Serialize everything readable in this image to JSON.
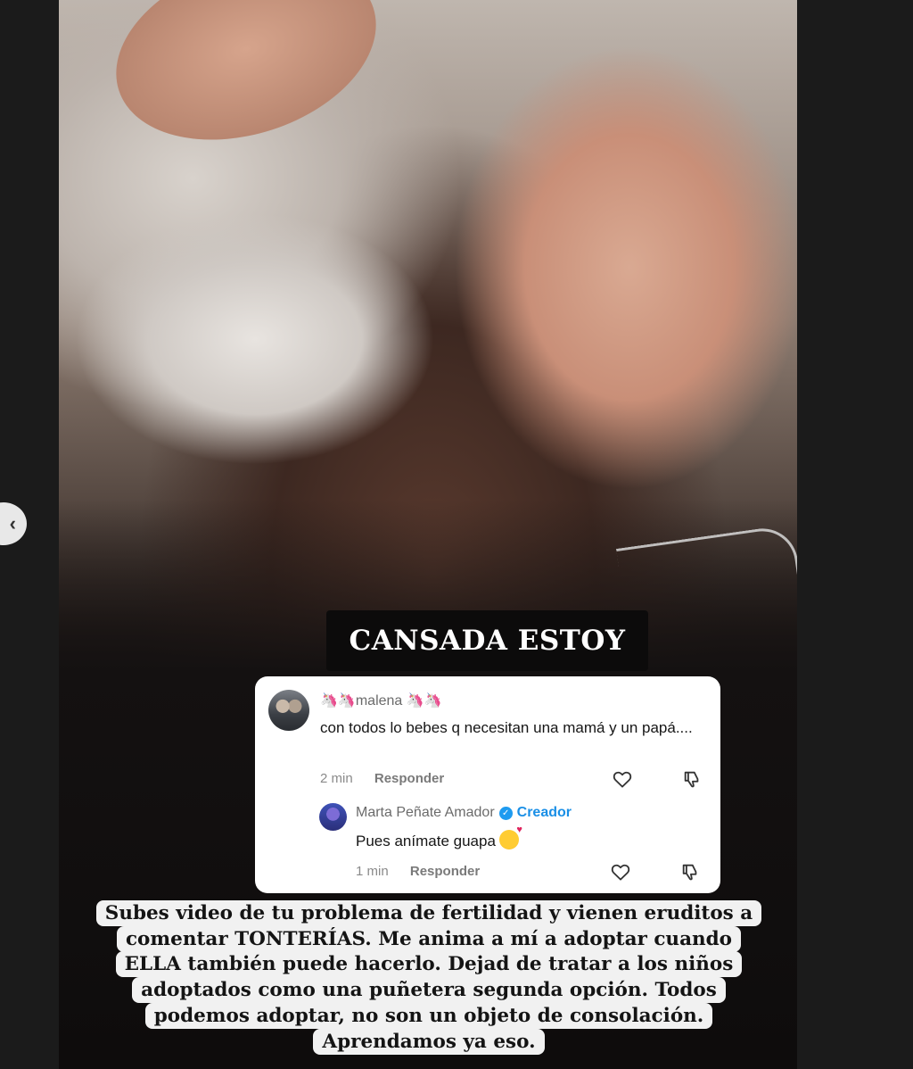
{
  "story": {
    "headline": "CANSADA ESTOY",
    "caption": "Subes video de tu problema de fertilidad y vienen eruditos a comentar TONTERÍAS. Me anima a mí a adoptar cuando ELLA también puede hacerlo. Dejad de tratar a los niños adoptados como una puñetera segunda opción. Todos podemos adoptar, no son un objeto de consolación. Aprendamos ya eso."
  },
  "comment": {
    "username_emoji": "🦄🦄",
    "username": "malena",
    "username_emoji_after": "🦄🦄",
    "text": "con todos lo bebes q necesitan una mamá y un papá....",
    "time": "2 min",
    "reply_label": "Responder"
  },
  "reply": {
    "author": "Marta Peñate Amador",
    "badge": "Creador",
    "text": "Pues anímate guapa",
    "time": "1 min",
    "reply_label": "Responder"
  },
  "icons": {
    "prev": "chevron-left-icon",
    "like": "heart-icon",
    "dislike": "thumbs-down-icon",
    "verified": "verified-check-icon"
  }
}
